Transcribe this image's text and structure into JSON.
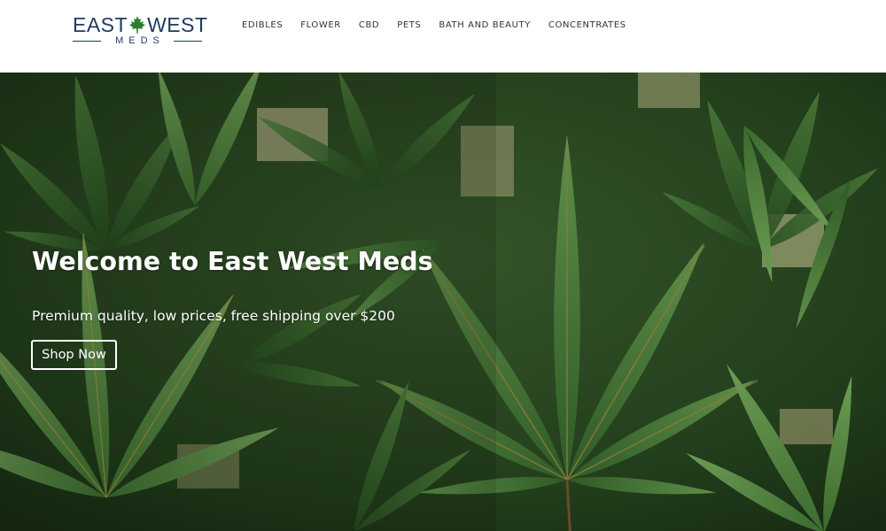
{
  "brand": {
    "logo_top_left": "EAST",
    "logo_top_right": "WEST",
    "logo_bottom": "MEDS",
    "logo_color": "#1f3a5f",
    "leaf_color": "#2e7d32",
    "leaf_icon": "maple-leaf-icon"
  },
  "nav": {
    "items": [
      {
        "label": "EDIBLES"
      },
      {
        "label": "FLOWER"
      },
      {
        "label": "CBD"
      },
      {
        "label": "PETS"
      },
      {
        "label": "BATH AND BEAUTY"
      },
      {
        "label": "CONCENTRATES"
      }
    ]
  },
  "hero": {
    "title": "Welcome to East West Meds",
    "subtitle": "Premium quality, low prices, free shipping over $200",
    "cta_label": "Shop Now",
    "background": "cannabis-leaves-photo",
    "text_color": "#ffffff"
  }
}
